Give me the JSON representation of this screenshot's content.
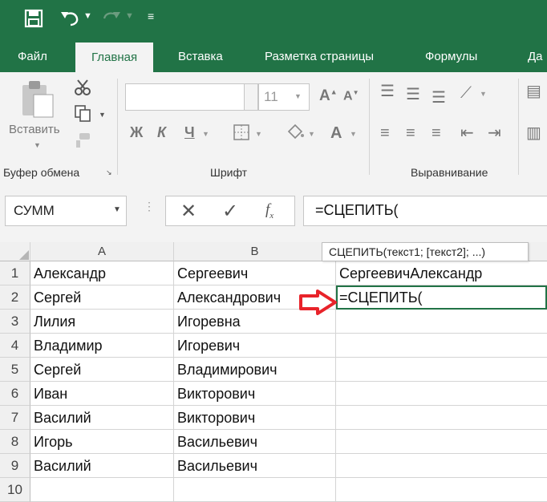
{
  "ribbon_tabs": [
    "Файл",
    "Главная",
    "Вставка",
    "Разметка страницы",
    "Формулы",
    "Да"
  ],
  "ribbon": {
    "paste_label": "Вставить",
    "group_clipboard": "Буфер обмена",
    "group_font": "Шрифт",
    "group_alignment": "Выравнивание",
    "font_size": "11",
    "bold": "Ж",
    "italic": "К",
    "underline": "Ч"
  },
  "formula_bar": {
    "name_box": "СУММ",
    "formula": "=СЦЕПИТЬ("
  },
  "tooltip": "СЦЕПИТЬ(текст1; [текст2]; ...)",
  "columns": [
    "A",
    "B"
  ],
  "rows": [
    {
      "n": "1",
      "a": "Александр",
      "b": "Сергеевич",
      "c": "СергеевичАлександр"
    },
    {
      "n": "2",
      "a": "Сергей",
      "b": "Александрович",
      "c": "=СЦЕПИТЬ("
    },
    {
      "n": "3",
      "a": "Лилия",
      "b": "Игоревна",
      "c": ""
    },
    {
      "n": "4",
      "a": "Владимир",
      "b": "Игоревич",
      "c": ""
    },
    {
      "n": "5",
      "a": "Сергей",
      "b": "Владимирович",
      "c": ""
    },
    {
      "n": "6",
      "a": "Иван",
      "b": "Викторович",
      "c": ""
    },
    {
      "n": "7",
      "a": "Василий",
      "b": "Викторович",
      "c": ""
    },
    {
      "n": "8",
      "a": "Игорь",
      "b": "Васильевич",
      "c": ""
    },
    {
      "n": "9",
      "a": "Василий",
      "b": "Васильевич",
      "c": ""
    },
    {
      "n": "10",
      "a": "",
      "b": "",
      "c": ""
    }
  ],
  "colors": {
    "accent": "#217346",
    "arrow": "#e8232a",
    "active_border": "#217346"
  }
}
